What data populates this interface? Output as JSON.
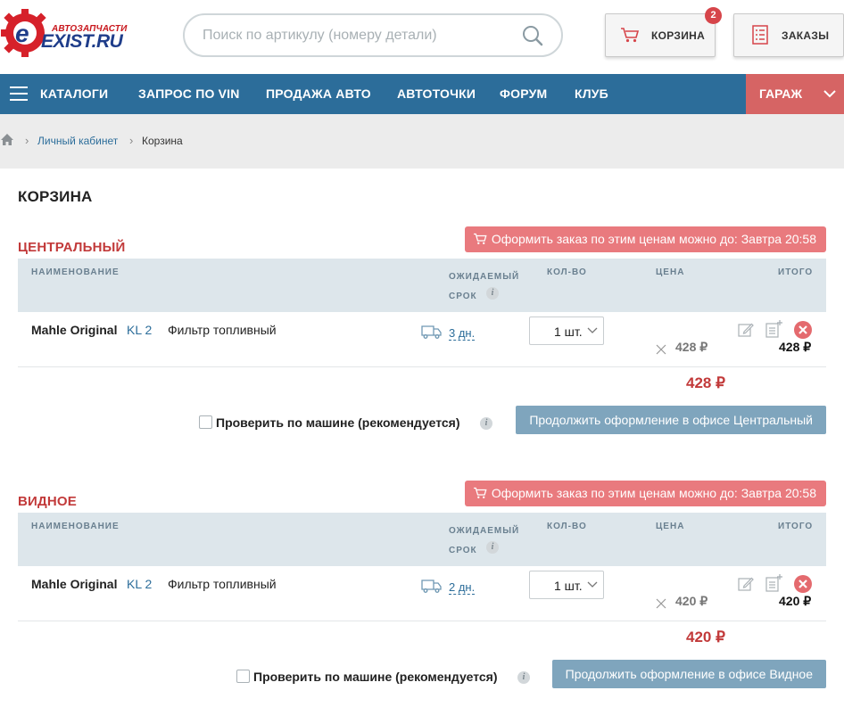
{
  "logo": {
    "small_text": "АВТОЗАПЧАСТИ",
    "brand": "EXIST.RU"
  },
  "search": {
    "placeholder": "Поиск по артикулу (номеру детали)"
  },
  "header": {
    "cart_label": "КОРЗИНА",
    "cart_count": "2",
    "orders_label": "ЗАКАЗЫ"
  },
  "nav": {
    "items": [
      "КАТАЛОГИ",
      "ЗАПРОС ПО VIN",
      "ПРОДАЖА АВТО",
      "АВТОТОЧКИ",
      "ФОРУМ",
      "КЛУБ"
    ],
    "garage": "ГАРАЖ"
  },
  "breadcrumb": {
    "items": [
      "Личный кабинет",
      "Корзина"
    ]
  },
  "page_title": "КОРЗИНА",
  "table_headers": {
    "name": "НАИМЕНОВАНИЕ",
    "expected": "ОЖИДАЕМЫЙ",
    "term": "СРОК",
    "qty": "КОЛ-ВО",
    "price": "ЦЕНА",
    "total": "ИТОГО",
    "info": "i"
  },
  "sections": [
    {
      "title": "ЦЕНТРАЛЬНЫЙ",
      "deadline": "Оформить заказ по этим ценам можно до: Завтра 20:58",
      "item": {
        "brand": "Mahle Original",
        "article": "KL 2",
        "description": "Фильтр топливный",
        "delivery": "3 дн.",
        "qty": "1 шт.",
        "price": "428 ₽",
        "total": "428 ₽"
      },
      "subtotal": "428 ₽",
      "check_label": "Проверить по машине (рекомендуется)",
      "continue_label": "Продолжить оформление в офисе Центральный"
    },
    {
      "title": "ВИДНОЕ",
      "deadline": "Оформить заказ по этим ценам можно до: Завтра 20:58",
      "item": {
        "brand": "Mahle Original",
        "article": "KL 2",
        "description": "Фильтр топливный",
        "delivery": "2 дн.",
        "qty": "1 шт.",
        "price": "420 ₽",
        "total": "420 ₽"
      },
      "subtotal": "420 ₽",
      "check_label": "Проверить по машине (рекомендуется)",
      "continue_label": "Продолжить оформление в офисе Видное"
    }
  ],
  "colors": {
    "nav": "#2c6d9a",
    "garage": "#d66464",
    "accent_red": "#c23a3a",
    "deadline": "#e97a7e",
    "button": "#7fa5bd"
  }
}
